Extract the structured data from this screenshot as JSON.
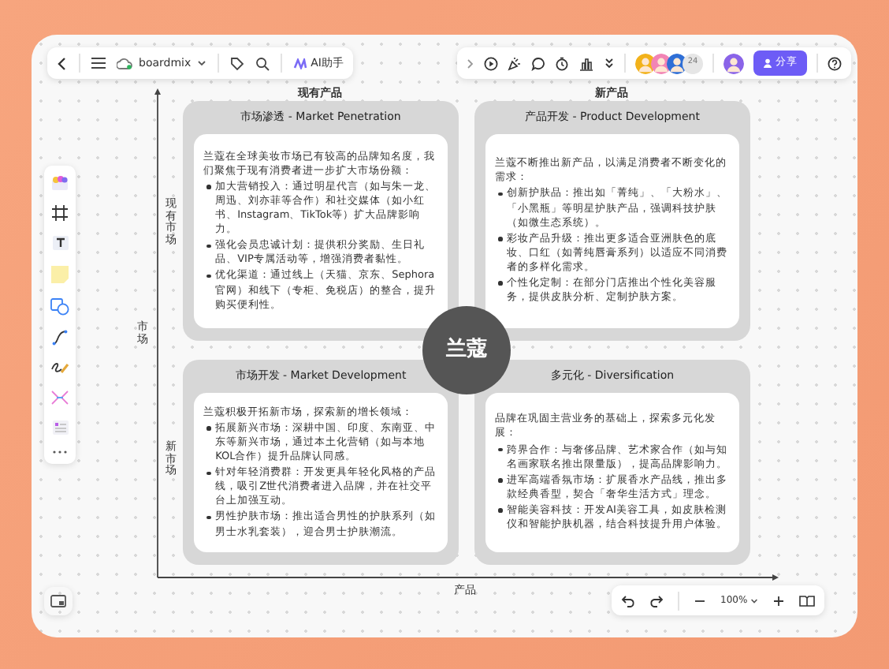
{
  "top_bar": {
    "app_name": "boardmix",
    "ai_button": "AI助手",
    "collaborator_count": "24",
    "share_button": "分享"
  },
  "zoom_bar": {
    "zoom": "100%"
  },
  "matrix": {
    "center": "兰蔻",
    "x_axis": "产品",
    "y_axis": "市场",
    "columns": [
      "现有产品",
      "新产品"
    ],
    "rows": [
      "现有市场",
      "新市场"
    ],
    "quadrants": [
      {
        "title": "市场渗透 - Market Penetration",
        "intro": "兰蔻在全球美妆市场已有较高的品牌知名度，我们聚焦于现有消费者进一步扩大市场份额：",
        "bullets": [
          "加大营销投入：通过明星代言（如与朱一龙、周迅、刘亦菲等合作）和社交媒体（如小红书、Instagram、TikTok等）扩大品牌影响力。",
          "强化会员忠诚计划：提供积分奖励、生日礼品、VIP专属活动等，增强消费者黏性。",
          "优化渠道：通过线上（天猫、京东、Sephora官网）和线下（专柜、免税店）的整合，提升购买便利性。"
        ]
      },
      {
        "title": "产品开发 - Product Development",
        "intro": "兰蔻不断推出新产品，以满足消费者不断变化的需求：",
        "bullets": [
          "创新护肤品：推出如「菁纯」、「大粉水」、「小黑瓶」等明星护肤产品，强调科技护肤（如微生态系统）。",
          "彩妆产品升级：推出更多适合亚洲肤色的底妆、口红（如菁纯唇膏系列）以适应不同消费者的多样化需求。",
          "个性化定制：在部分门店推出个性化美容服务，提供皮肤分析、定制护肤方案。"
        ]
      },
      {
        "title": "市场开发 - Market Development",
        "intro": "兰蔻积极开拓新市场，探索新的增长领域：",
        "bullets": [
          "拓展新兴市场：深耕中国、印度、东南亚、中东等新兴市场，通过本土化营销（如与本地KOL合作）提升品牌认同感。",
          "针对年轻消费群：开发更具年轻化风格的产品线，吸引Z世代消费者进入品牌，并在社交平台上加强互动。",
          "男性护肤市场：推出适合男性的护肤系列（如男士水乳套装），迎合男士护肤潮流。"
        ]
      },
      {
        "title": "多元化 - Diversification",
        "intro": "品牌在巩固主营业务的基础上，探索多元化发展：",
        "bullets": [
          "跨界合作：与奢侈品牌、艺术家合作（如与知名画家联名推出限量版），提高品牌影响力。",
          "进军高端香氛市场：扩展香水产品线，推出多款经典香型，契合「奢华生活方式」理念。",
          "智能美容科技：开发AI美容工具，如皮肤检测仪和智能护肤机器，结合科技提升用户体验。"
        ]
      }
    ]
  }
}
